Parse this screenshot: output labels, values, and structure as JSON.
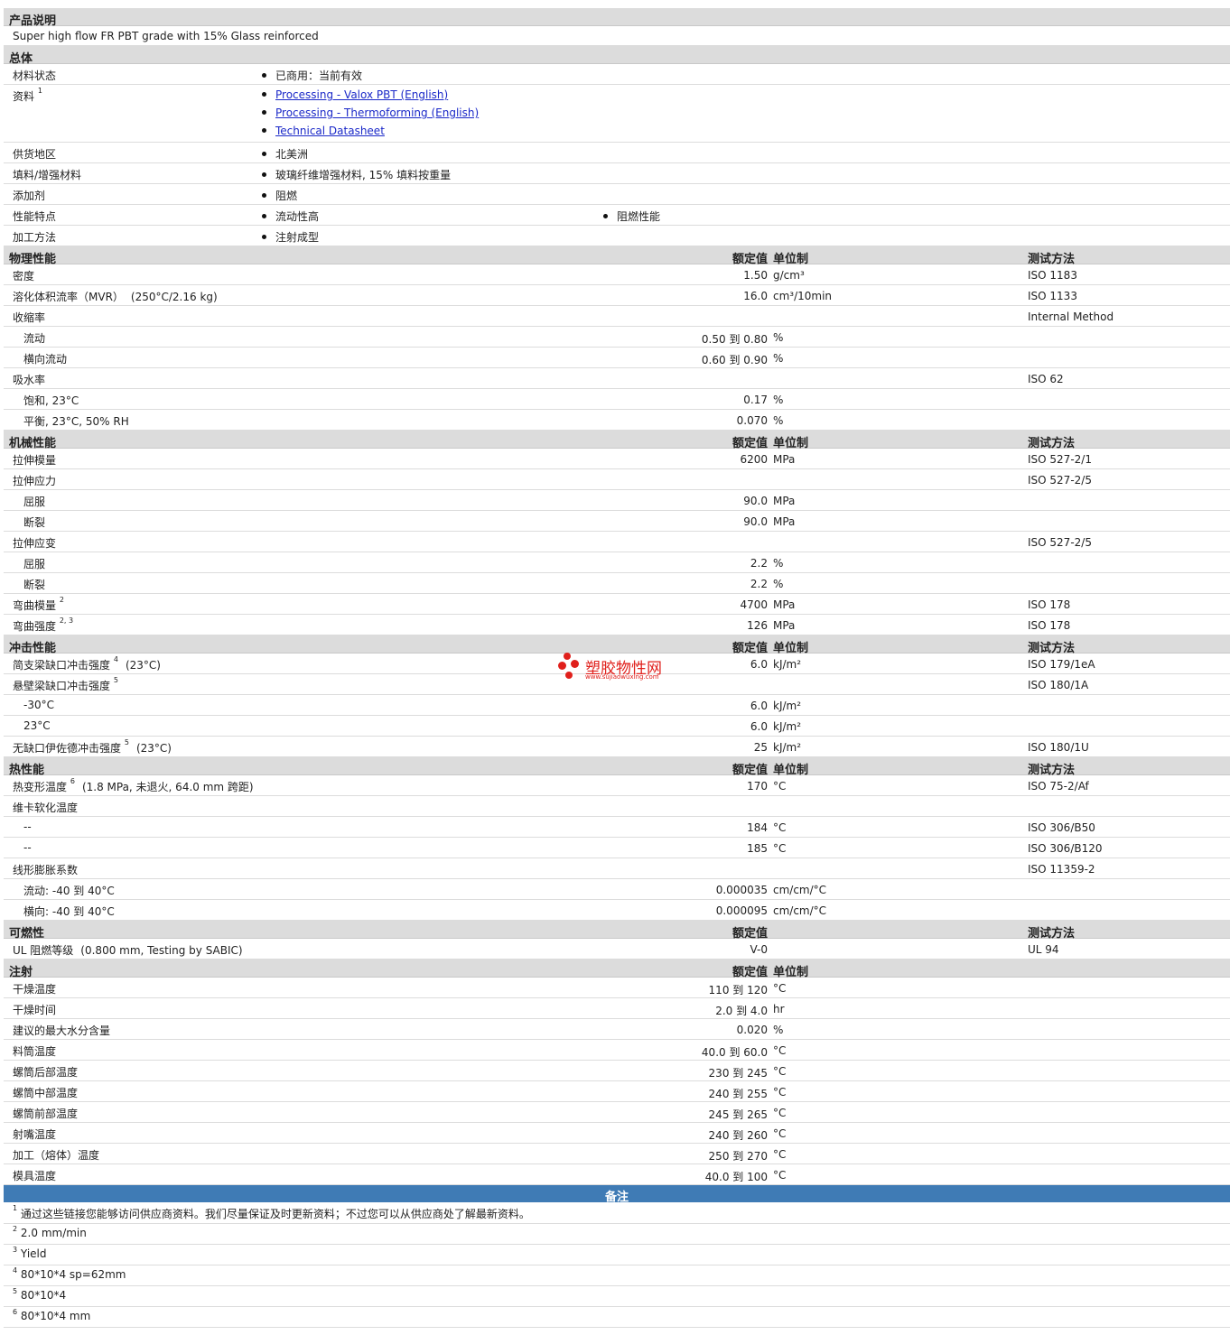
{
  "desc": {
    "title": "产品说明",
    "text": "Super high flow FR PBT grade with 15% Glass reinforced"
  },
  "general": {
    "title": "总体",
    "status_label": "材料状态",
    "status_value": "已商用：当前有效",
    "docs_label": "资料",
    "docs_sup": "1",
    "docs": [
      "Processing - Valox PBT (English)",
      "Processing - Thermoforming (English)",
      "Technical Datasheet"
    ],
    "region_label": "供货地区",
    "region_value": "北美洲",
    "filler_label": "填料/增强材料",
    "filler_value": "玻璃纤维增强材料, 15% 填料按重量",
    "additive_label": "添加剂",
    "additive_value": "阻燃",
    "feature_label": "性能特点",
    "feature_1": "流动性高",
    "feature_2": "阻燃性能",
    "process_label": "加工方法",
    "process_value": "注射成型"
  },
  "headers": {
    "nominal": "额定值",
    "unit": "单位制",
    "method": "测试方法"
  },
  "physical": {
    "title": "物理性能",
    "rows": [
      {
        "label": "密度",
        "value": "1.50",
        "unit": "g/cm³",
        "method": "ISO 1183"
      },
      {
        "label": "溶化体积流率（MVR）",
        "cond": "(250°C/2.16 kg)",
        "value": "16.0",
        "unit": "cm³/10min",
        "method": "ISO 1133"
      },
      {
        "label": "收缩率",
        "method": "Internal Method"
      },
      {
        "label": "流动",
        "sub": true,
        "value": "0.50 到  0.80",
        "unit": "%"
      },
      {
        "label": "横向流动",
        "sub": true,
        "value": "0.60 到  0.90",
        "unit": "%"
      },
      {
        "label": "吸水率",
        "method": "ISO 62"
      },
      {
        "label": "饱和, 23°C",
        "sub": true,
        "value": "0.17",
        "unit": "%"
      },
      {
        "label": "平衡, 23°C, 50% RH",
        "sub": true,
        "value": "0.070",
        "unit": "%"
      }
    ]
  },
  "mechanical": {
    "title": "机械性能",
    "rows": [
      {
        "label": "拉伸模量",
        "value": "6200",
        "unit": "MPa",
        "method": "ISO 527-2/1"
      },
      {
        "label": "拉伸应力",
        "method": "ISO 527-2/5"
      },
      {
        "label": "屈服",
        "sub": true,
        "value": "90.0",
        "unit": "MPa"
      },
      {
        "label": "断裂",
        "sub": true,
        "value": "90.0",
        "unit": "MPa"
      },
      {
        "label": "拉伸应变",
        "method": "ISO 527-2/5"
      },
      {
        "label": "屈服",
        "sub": true,
        "value": "2.2",
        "unit": "%"
      },
      {
        "label": "断裂",
        "sub": true,
        "value": "2.2",
        "unit": "%"
      },
      {
        "label": "弯曲模量",
        "sup": "2",
        "value": "4700",
        "unit": "MPa",
        "method": "ISO 178"
      },
      {
        "label": "弯曲强度",
        "sup": "2, 3",
        "value": "126",
        "unit": "MPa",
        "method": "ISO 178"
      }
    ]
  },
  "impact": {
    "title": "冲击性能",
    "rows": [
      {
        "label": "简支梁缺口冲击强度",
        "sup": "4",
        "cond": "(23°C)",
        "value": "6.0",
        "unit": "kJ/m²",
        "method": "ISO 179/1eA"
      },
      {
        "label": "悬壁梁缺口冲击强度",
        "sup": "5",
        "method": "ISO 180/1A"
      },
      {
        "label": "-30°C",
        "sub": true,
        "value": "6.0",
        "unit": "kJ/m²"
      },
      {
        "label": "23°C",
        "sub": true,
        "value": "6.0",
        "unit": "kJ/m²"
      },
      {
        "label": "无缺口伊佐德冲击强度",
        "sup": "5",
        "cond": "(23°C)",
        "value": "25",
        "unit": "kJ/m²",
        "method": "ISO 180/1U"
      }
    ]
  },
  "thermal": {
    "title": "热性能",
    "rows": [
      {
        "label": "热变形温度",
        "sup": "6",
        "cond": "(1.8 MPa, 未退火, 64.0 mm 跨距)",
        "value": "170",
        "unit": "°C",
        "method": "ISO 75-2/Af"
      },
      {
        "label": "维卡软化温度"
      },
      {
        "label": "--",
        "sub": true,
        "value": "184",
        "unit": "°C",
        "method": "ISO 306/B50"
      },
      {
        "label": "--",
        "sub": true,
        "value": "185",
        "unit": "°C",
        "method": "ISO 306/B120"
      },
      {
        "label": "线形膨胀系数",
        "method": "ISO 11359-2"
      },
      {
        "label": "流动: -40 到  40°C",
        "sub": true,
        "value": "0.000035",
        "unit": "cm/cm/°C"
      },
      {
        "label": "横向: -40 到  40°C",
        "sub": true,
        "value": "0.000095",
        "unit": "cm/cm/°C"
      }
    ]
  },
  "flammability": {
    "title": "可燃性",
    "rows": [
      {
        "label": "UL 阻燃等级",
        "cond": "(0.800 mm, Testing by SABIC)",
        "value": "V-0",
        "method": "UL 94"
      }
    ]
  },
  "injection": {
    "title": "注射",
    "rows": [
      {
        "label": "干燥温度",
        "value": "110 到  120",
        "unit": "°C"
      },
      {
        "label": "干燥时间",
        "value": "2.0 到  4.0",
        "unit": "hr"
      },
      {
        "label": "建议的最大水分含量",
        "value": "0.020",
        "unit": "%"
      },
      {
        "label": "料筒温度",
        "value": "40.0 到  60.0",
        "unit": "°C"
      },
      {
        "label": "螺筒后部温度",
        "value": "230 到  245",
        "unit": "°C"
      },
      {
        "label": "螺筒中部温度",
        "value": "240 到  255",
        "unit": "°C"
      },
      {
        "label": "螺筒前部温度",
        "value": "245 到  265",
        "unit": "°C"
      },
      {
        "label": "射嘴温度",
        "value": "240 到  260",
        "unit": "°C"
      },
      {
        "label": "加工（熔体）温度",
        "value": "250 到  270",
        "unit": "°C"
      },
      {
        "label": "模具温度",
        "value": "40.0 到  100",
        "unit": "°C"
      }
    ]
  },
  "notes": {
    "title": "备注",
    "items": [
      {
        "sup": "1",
        "text": "通过这些链接您能够访问供应商资料。我们尽量保证及时更新资料；不过您可以从供应商处了解最新资料。"
      },
      {
        "sup": "2",
        "text": "2.0 mm/min"
      },
      {
        "sup": "3",
        "text": "Yield"
      },
      {
        "sup": "4",
        "text": "80*10*4 sp=62mm"
      },
      {
        "sup": "5",
        "text": "80*10*4"
      },
      {
        "sup": "6",
        "text": "80*10*4 mm"
      }
    ]
  },
  "watermark": {
    "text": "塑胶物性网",
    "url": "www.sujiaowuxing.com",
    "color": "#e0201c"
  }
}
